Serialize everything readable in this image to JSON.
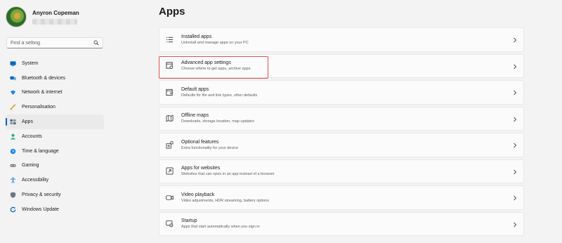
{
  "profile": {
    "name": "Anyron Copeman"
  },
  "search": {
    "placeholder": "Find a setting"
  },
  "nav": [
    {
      "label": "System",
      "icon": "monitor-icon",
      "color": "#0067c0",
      "active": false
    },
    {
      "label": "Bluetooth & devices",
      "icon": "bluetooth-icon",
      "color": "#0067c0",
      "active": false
    },
    {
      "label": "Network & internet",
      "icon": "wifi-icon",
      "color": "#1e88e5",
      "active": false
    },
    {
      "label": "Personalisation",
      "icon": "brush-icon",
      "color": "#d98c3a",
      "active": false
    },
    {
      "label": "Apps",
      "icon": "apps-icon",
      "color": "#5a6b7d",
      "active": true
    },
    {
      "label": "Accounts",
      "icon": "person-icon",
      "color": "#2eaa6e",
      "active": false
    },
    {
      "label": "Time & language",
      "icon": "globe-clock-icon",
      "color": "#1e88e5",
      "active": false
    },
    {
      "label": "Gaming",
      "icon": "gamepad-icon",
      "color": "#7b7b7b",
      "active": false
    },
    {
      "label": "Accessibility",
      "icon": "accessibility-icon",
      "color": "#1e88e5",
      "active": false
    },
    {
      "label": "Privacy & security",
      "icon": "shield-icon",
      "color": "#6b7785",
      "active": false
    },
    {
      "label": "Windows Update",
      "icon": "update-icon",
      "color": "#0067c0",
      "active": false
    }
  ],
  "main": {
    "title": "Apps",
    "items": [
      {
        "title": "Installed apps",
        "subtitle": "Uninstall and manage apps on your PC",
        "icon": "list-icon"
      },
      {
        "title": "Advanced app settings",
        "subtitle": "Choose where to get apps, archive apps",
        "icon": "advanced-settings-icon"
      },
      {
        "title": "Default apps",
        "subtitle": "Defaults for file and link types, other defaults",
        "icon": "default-apps-icon"
      },
      {
        "title": "Offline maps",
        "subtitle": "Downloads, storage location, map updates",
        "icon": "map-icon"
      },
      {
        "title": "Optional features",
        "subtitle": "Extra functionality for your device",
        "icon": "optional-features-icon"
      },
      {
        "title": "Apps for websites",
        "subtitle": "Websites that can open in an app instead of a browser",
        "icon": "open-link-icon"
      },
      {
        "title": "Video playback",
        "subtitle": "Video adjustments, HDR streaming, battery options",
        "icon": "video-icon"
      },
      {
        "title": "Startup",
        "subtitle": "Apps that start automatically when you sign in",
        "icon": "startup-icon"
      }
    ]
  },
  "highlight_color": "#d9534f",
  "accent": "#005fb8"
}
